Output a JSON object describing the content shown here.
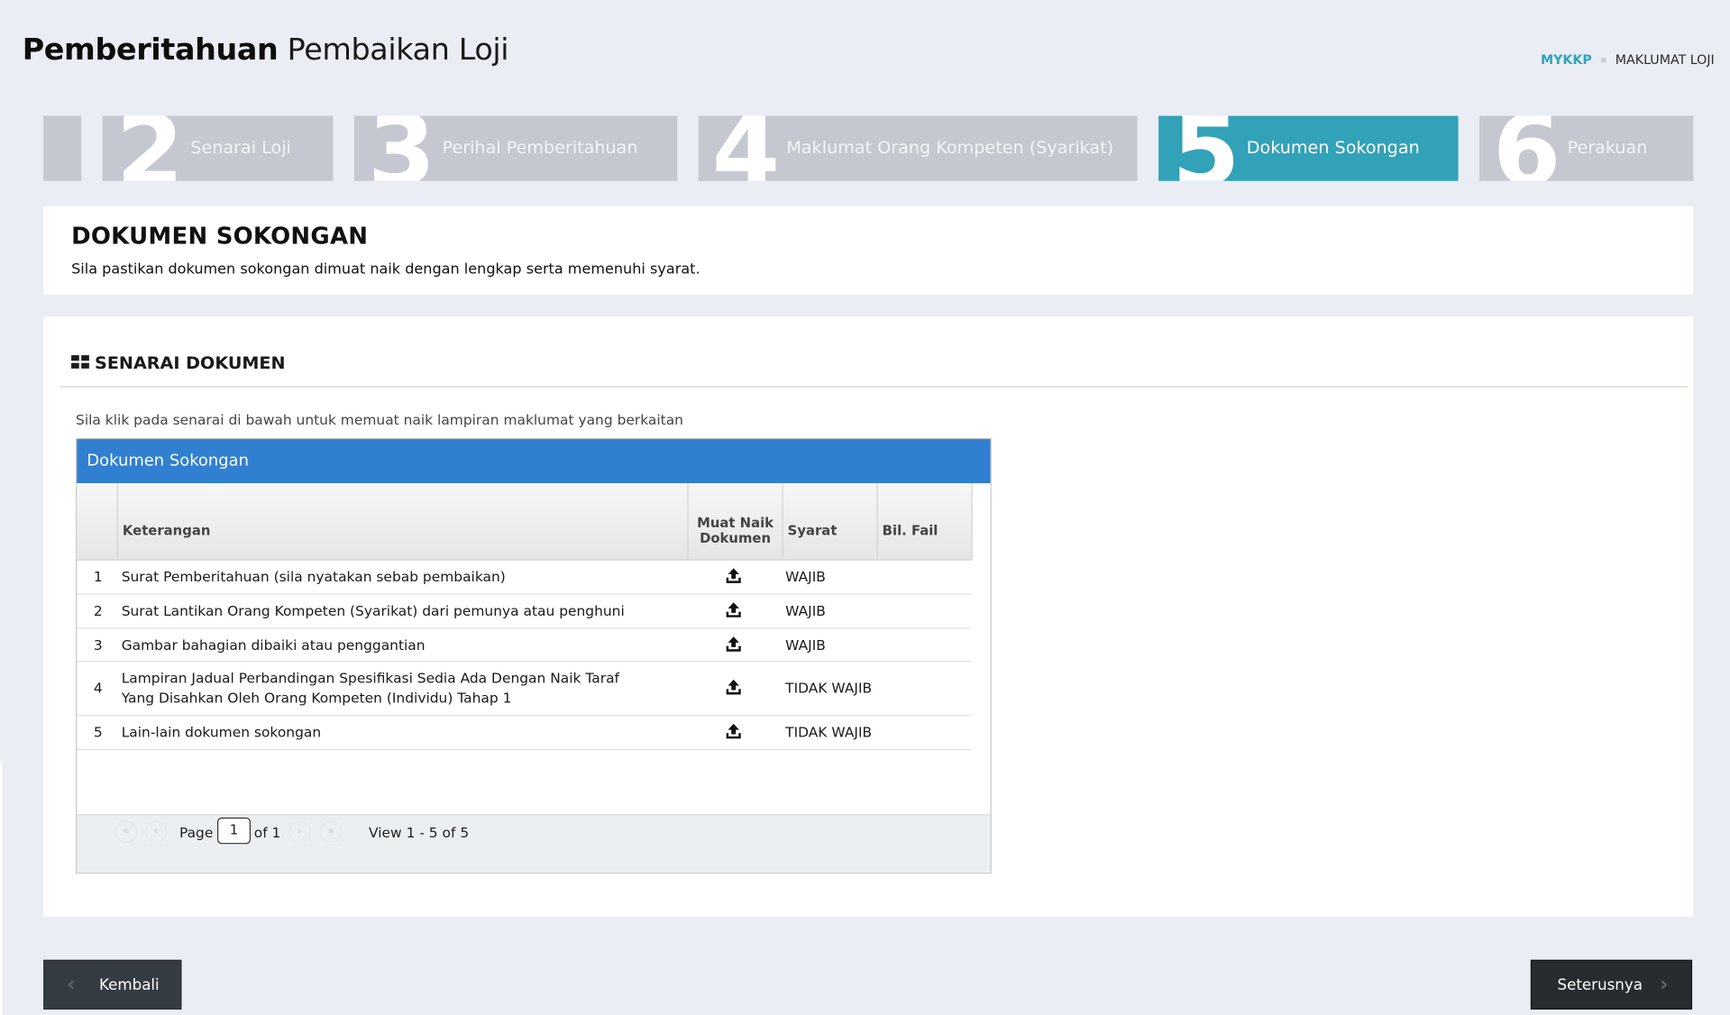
{
  "header": {
    "title_bold": "Pemberitahuan",
    "title_light": "Pembaikan Loji",
    "breadcrumb": {
      "home": "MYKKP",
      "current": "MAKLUMAT LOJI"
    }
  },
  "wizard": {
    "steps": [
      {
        "num": "2",
        "label": "Senarai Loji"
      },
      {
        "num": "3",
        "label": "Perihal Pemberitahuan"
      },
      {
        "num": "4",
        "label": "Maklumat Orang Kompeten (Syarikat)"
      },
      {
        "num": "5",
        "label": "Dokumen Sokongan",
        "active": true
      },
      {
        "num": "6",
        "label": "Perakuan"
      }
    ]
  },
  "intro": {
    "title": "DOKUMEN SOKONGAN",
    "description": "Sila pastikan dokumen sokongan dimuat naik dengan lengkap serta memenuhi syarat."
  },
  "section": {
    "title": "SENARAI DOKUMEN",
    "icon": "grid-icon",
    "hint": "Sila klik pada senarai di bawah untuk memuat naik lampiran maklumat yang berkaitan"
  },
  "table": {
    "caption": "Dokumen Sokongan",
    "columns": {
      "keterangan": "Keterangan",
      "muat_naik_1": "Muat Naik",
      "muat_naik_2": "Dokumen",
      "syarat": "Syarat",
      "bil_fail": "Bil. Fail"
    },
    "rows": [
      {
        "no": "1",
        "desc": "Surat Pemberitahuan (sila nyatakan sebab pembaikan)",
        "syarat": "WAJIB",
        "bil_fail": ""
      },
      {
        "no": "2",
        "desc": "Surat Lantikan Orang Kompeten (Syarikat) dari pemunya atau penghuni",
        "syarat": "WAJIB",
        "bil_fail": ""
      },
      {
        "no": "3",
        "desc": "Gambar bahagian dibaiki atau penggantian",
        "syarat": "WAJIB",
        "bil_fail": ""
      },
      {
        "no": "4",
        "desc": "Lampiran Jadual Perbandingan Spesifikasi Sedia Ada Dengan Naik Taraf Yang Disahkan Oleh Orang Kompeten (Individu) Tahap 1",
        "syarat": "TIDAK WAJIB",
        "bil_fail": ""
      },
      {
        "no": "5",
        "desc": "Lain-lain dokumen sokongan",
        "syarat": "TIDAK WAJIB",
        "bil_fail": ""
      }
    ],
    "pager": {
      "page_label": "Page",
      "page_value": "1",
      "of_label": "of 1",
      "view_text": "View 1 - 5 of 5"
    }
  },
  "footer": {
    "back_label": "Kembali",
    "next_label": "Seterusnya"
  },
  "colors": {
    "accent": "#31a2b8",
    "table_header": "#317fd1",
    "step_inactive": "#c5c8d0",
    "button": "#353b43"
  }
}
